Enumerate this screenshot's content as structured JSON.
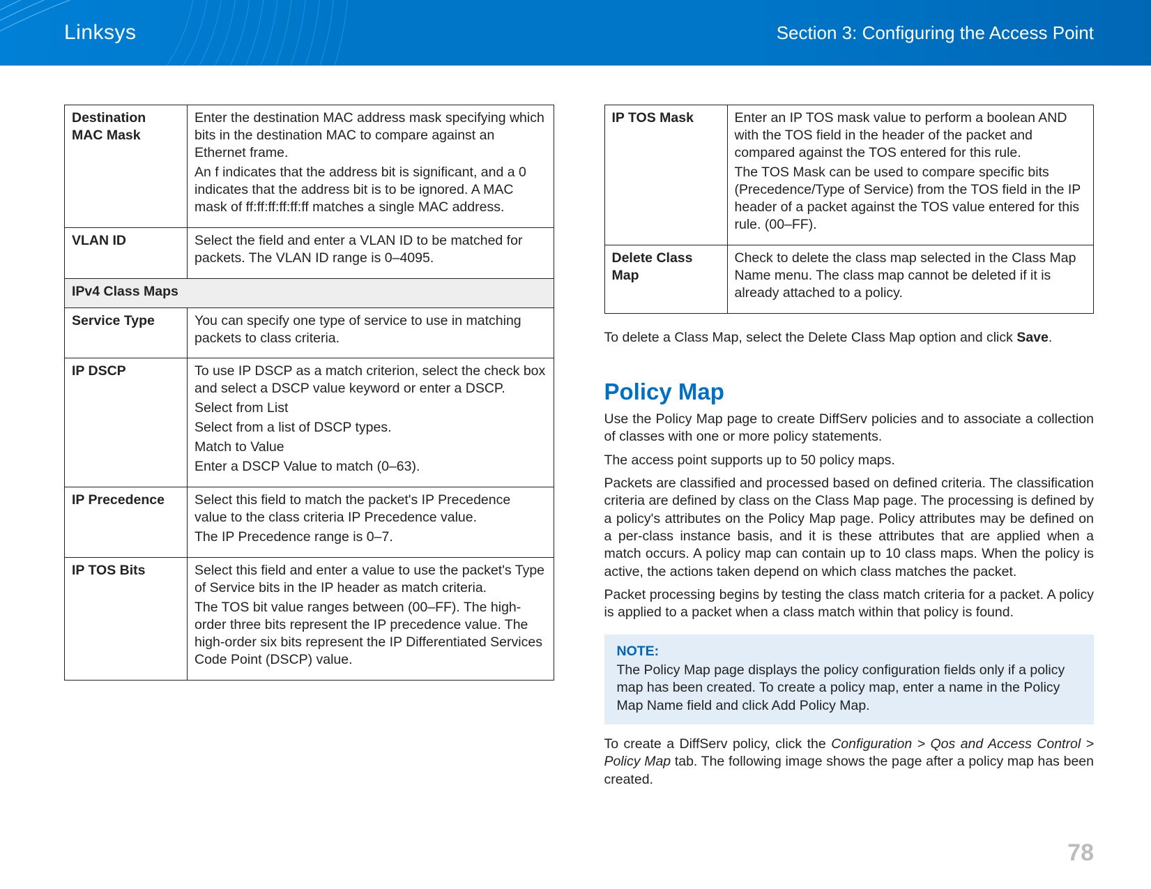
{
  "header": {
    "brand": "Linksys",
    "section": "Section 3:  Configuring the Access Point"
  },
  "page_number": "78",
  "left_table": {
    "rows": [
      {
        "label": "Destination MAC Mask",
        "paras": [
          "Enter the destination MAC address mask specifying which bits in the destination MAC to compare against an Ethernet frame.",
          "An f indicates that the address bit is significant, and a 0 indicates that the address bit is to be ignored. A MAC mask of ff:ff:ff:ff:ff:ff matches a single MAC address."
        ]
      },
      {
        "label": "VLAN ID",
        "paras": [
          "Select the field and enter a VLAN ID to be matched for packets. The VLAN ID range is 0–4095."
        ]
      },
      {
        "section_head": "IPv4 Class Maps"
      },
      {
        "label": "Service Type",
        "paras": [
          "You can specify one type of service to use in matching packets to class criteria."
        ]
      },
      {
        "label": "IP DSCP",
        "paras": [
          "To use IP DSCP as a match criterion, select the check box and select a DSCP value keyword or enter a DSCP.",
          "Select from List",
          "Select from a list of DSCP types.",
          "Match to Value",
          "Enter a DSCP Value to match (0–63)."
        ]
      },
      {
        "label": "IP Precedence",
        "paras": [
          "Select this field to match the packet's IP Precedence value to the class criteria IP Precedence value.",
          "The IP Precedence range is 0–7."
        ]
      },
      {
        "label": "IP TOS Bits",
        "paras": [
          "Select this field and enter a value to use the packet's Type of Service bits in the IP header as match criteria.",
          "The TOS bit value ranges between (00–FF). The high-order three bits represent the IP precedence value. The high-order six bits represent the IP Differentiated Services Code Point (DSCP) value."
        ]
      }
    ]
  },
  "right_table": {
    "rows": [
      {
        "label": "IP TOS Mask",
        "paras": [
          "Enter an IP TOS mask value to perform a boolean AND with the TOS field in the header of the packet and compared against the TOS entered for this rule.",
          "The TOS Mask can be used to compare specific bits (Precedence/Type of Service) from the TOS field in the IP header of a packet against the TOS value entered for this rule. (00–FF)."
        ]
      },
      {
        "label": "Delete Class Map",
        "paras": [
          "Check to delete the class map selected in the Class Map Name menu. The class map cannot be deleted if it is already attached to a policy."
        ]
      }
    ]
  },
  "delete_instruction": {
    "pre": "To delete a Class Map, select the Delete Class Map option and click ",
    "bold": "Save",
    "post": "."
  },
  "policy_map": {
    "title": "Policy Map",
    "paras": [
      "Use the Policy Map page to create DiffServ policies and to associate a collection of classes with one or more policy statements.",
      "The access point supports up to 50 policy maps.",
      "Packets are classified and processed based on defined criteria. The classification criteria are defined by class on the Class Map page. The processing is defined by a policy's attributes on the Policy Map page. Policy attributes may be defined on a per-class instance basis, and it is these attributes that are applied when a match occurs. A policy map can contain up to 10 class maps. When the policy is active, the actions taken depend on which class matches the packet.",
      "Packet processing begins by testing the class match criteria for a packet. A policy is applied to a packet when a class match within that policy is found."
    ],
    "note": {
      "label": "NOTE:",
      "text": "The Policy Map page displays the policy configuration fields only if a policy map has been created. To create a policy map, enter a name in the Policy Map Name field and click Add Policy Map."
    },
    "tail": {
      "pre": "To create a DiffServ policy, click the ",
      "italic": "Configuration > Qos and Access Control > Policy Map",
      "post": " tab. The following image shows the page after a policy map has been created."
    }
  }
}
